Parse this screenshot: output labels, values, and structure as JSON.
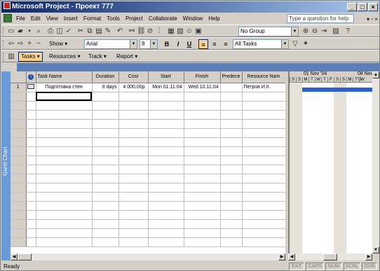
{
  "window": {
    "title": "Microsoft Project - Проект 777"
  },
  "menu": {
    "items": [
      "File",
      "Edit",
      "View",
      "Insert",
      "Format",
      "Tools",
      "Project",
      "Collaborate",
      "Window",
      "Help"
    ],
    "help_placeholder": "Type a question for help"
  },
  "toolbar_standard": {
    "group_value": "No Group"
  },
  "toolbar_formatting": {
    "show_value": "Show",
    "font_value": "Arial",
    "size_value": "8",
    "bold": "B",
    "italic": "I",
    "underline": "U",
    "filter_value": "All Tasks"
  },
  "project_guide": {
    "tasks": "Tasks",
    "resources": "Resources",
    "track": "Track",
    "report": "Report"
  },
  "view_bar": {
    "label": "Gantt Chart"
  },
  "grid": {
    "columns": [
      "",
      "",
      "Task Name",
      "Duration",
      "Cost",
      "Start",
      "Finish",
      "Predece",
      "Resource Nam"
    ],
    "rows": [
      {
        "id": "1",
        "name": "Подготовка стен",
        "duration": "8 days",
        "cost": "4 000,00р.",
        "start": "Mon 01.11.04",
        "finish": "Wed 10.11.04",
        "predecessors": "",
        "resource": "Петров И.К."
      }
    ]
  },
  "gantt": {
    "weeks": [
      "01 Nov '04",
      "08 Nov '0"
    ],
    "days": [
      "S",
      "S",
      "M",
      "T",
      "W",
      "T",
      "F",
      "S",
      "S",
      "M",
      "T",
      "W"
    ]
  },
  "status": {
    "text": "Ready",
    "indicators": [
      "EXT",
      "CAPS",
      "NUM",
      "SCRL",
      "OVR"
    ]
  },
  "colors": {
    "title_start": "#0a246a",
    "title_end": "#a6caf0",
    "gantt_bar": "#2a5fd6",
    "view_bar": "#6a9bd8"
  }
}
